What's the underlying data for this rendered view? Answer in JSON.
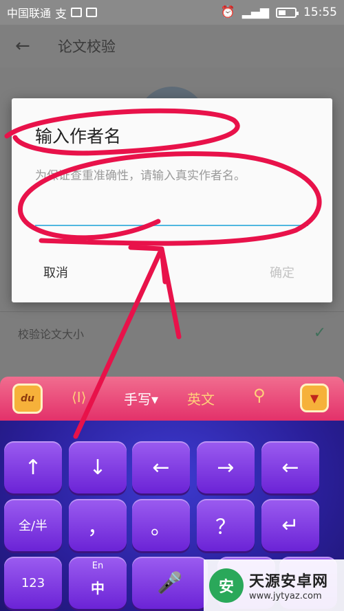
{
  "status_bar": {
    "carrier": "中国联通",
    "carrier_extra": "支",
    "time": "15:55",
    "signal_label": "4G",
    "battery_level": 0.45
  },
  "app_bar": {
    "back_icon": "arrow-left-icon",
    "title": "论文校验"
  },
  "background_list": {
    "row1_label": "校验论文大小"
  },
  "dialog": {
    "title": "输入作者名",
    "hint": "为保证查重准确性，请输入真实作者名。",
    "input_value": "",
    "cancel_label": "取消",
    "confirm_label": "确定",
    "accent_color": "#4fb7df"
  },
  "keyboard": {
    "logo_label": "du",
    "handwrite_label": "手写",
    "english_label": "英文",
    "row1": [
      "↑",
      "↓",
      "←",
      "→",
      "←"
    ],
    "row2": [
      "全/半",
      "，",
      "。",
      "？",
      "↵"
    ],
    "row3": [
      "123",
      "En",
      "中",
      "mic",
      "",
      ""
    ],
    "accent_color": "#e3316a"
  },
  "watermark": {
    "name": "天源安卓网",
    "url": "www.jytyaz.com"
  }
}
